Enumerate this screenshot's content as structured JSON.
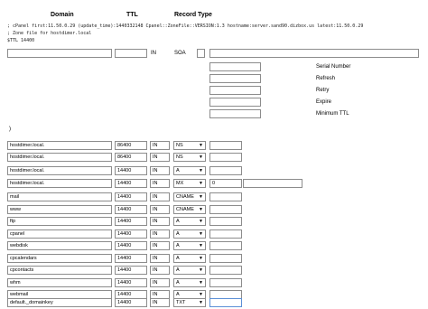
{
  "headers": {
    "domain": "Domain",
    "ttl": "TTL",
    "record_type": "Record Type"
  },
  "zone_comments": [
    "; cPanel first:11.50.0.29 (update_time):1440332148 Cpanel::ZoneFile::VERSION:1.3 hostname:server.sand90.dizbox.us latest:11.50.0.29",
    "; Zone file for hostdimer.local",
    "$TTL 14400"
  ],
  "soa": {
    "in_label": "IN",
    "type_label": "SOA",
    "fields": [
      "Serial Number",
      "Refresh",
      "Retry",
      "Expire",
      "Minimum TTL"
    ]
  },
  "stray_char": ")",
  "records": [
    {
      "name": "hostdimer.local.",
      "ttl": "86400",
      "class": "IN",
      "type": "NS",
      "value": "",
      "extra": ""
    },
    {
      "name": "hostdimer.local.",
      "ttl": "86400",
      "class": "IN",
      "type": "NS",
      "value": "",
      "extra": ""
    },
    {
      "name": "hostdimer.local.",
      "ttl": "14400",
      "class": "IN",
      "type": "A",
      "value": "",
      "extra": ""
    },
    {
      "name": "hostdimer.local.",
      "ttl": "14400",
      "class": "IN",
      "type": "MX",
      "value": "0",
      "extra": ""
    },
    {
      "name": "mail",
      "ttl": "14400",
      "class": "IN",
      "type": "CNAME",
      "value": "",
      "extra": ""
    },
    {
      "name": "www",
      "ttl": "14400",
      "class": "IN",
      "type": "CNAME",
      "value": "",
      "extra": ""
    },
    {
      "name": "ftp",
      "ttl": "14400",
      "class": "IN",
      "type": "A",
      "value": "",
      "extra": ""
    },
    {
      "name": "cpanel",
      "ttl": "14400",
      "class": "IN",
      "type": "A",
      "value": "",
      "extra": ""
    },
    {
      "name": "webdisk",
      "ttl": "14400",
      "class": "IN",
      "type": "A",
      "value": "",
      "extra": ""
    },
    {
      "name": "cpcalendars",
      "ttl": "14400",
      "class": "IN",
      "type": "A",
      "value": "",
      "extra": ""
    },
    {
      "name": "cpcontacts",
      "ttl": "14400",
      "class": "IN",
      "type": "A",
      "value": "",
      "extra": ""
    },
    {
      "name": "whm",
      "ttl": "14400",
      "class": "IN",
      "type": "A",
      "value": "",
      "extra": ""
    },
    {
      "name": "webmail",
      "ttl": "14400",
      "class": "IN",
      "type": "A",
      "value": "",
      "extra": ""
    },
    {
      "name": "default._domainkey",
      "ttl": "14400",
      "class": "IN",
      "type": "TXT",
      "value": "",
      "extra": ""
    }
  ],
  "dropdown_arrow": "▼"
}
